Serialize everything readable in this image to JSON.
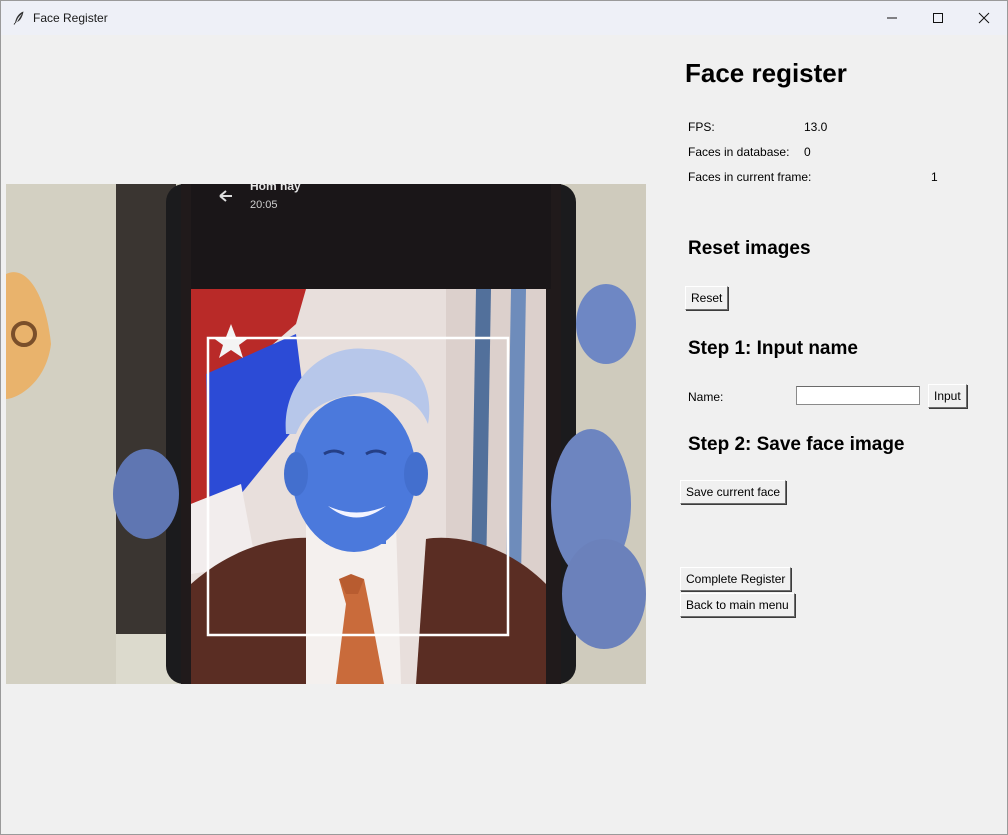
{
  "window": {
    "title": "Face Register",
    "controls": [
      "minimize-icon",
      "maximize-icon",
      "close-icon"
    ]
  },
  "camera": {
    "phone_title": "Hôm nay",
    "phone_time": "20:05"
  },
  "panel": {
    "heading": "Face register",
    "stats": {
      "fps_label": "FPS:",
      "fps_value": "13.0",
      "db_label": "Faces in database:",
      "db_value": "0",
      "frame_label": "Faces in current frame:",
      "frame_value": "1"
    },
    "reset": {
      "heading": "Reset images",
      "button": "Reset"
    },
    "step1": {
      "heading": "Step 1: Input name",
      "name_label": "Name:",
      "name_value": "",
      "button": "Input"
    },
    "step2": {
      "heading": "Step 2: Save face image",
      "button": "Save current face"
    },
    "complete_button": "Complete Register",
    "back_button": "Back to main menu"
  }
}
